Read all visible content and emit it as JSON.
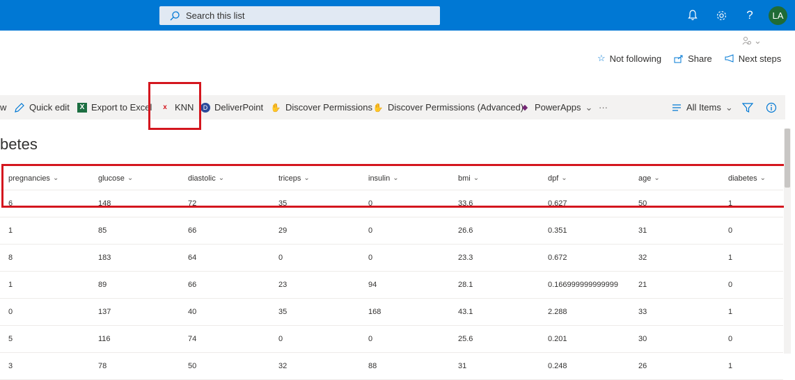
{
  "search": {
    "placeholder": "Search this list"
  },
  "suite": {
    "avatar_initials": "LA"
  },
  "header": {
    "not_following": "Not following",
    "share": "Share",
    "next_steps": "Next steps"
  },
  "commands": {
    "partial_left": "w",
    "quick_edit": "Quick edit",
    "export_excel": "Export to Excel",
    "knn": "KNN",
    "deliverpoint": "DeliverPoint",
    "discover_permissions": "Discover Permissions",
    "discover_permissions_adv": "Discover Permissions (Advanced)",
    "powerapps": "PowerApps",
    "more": "···",
    "all_items": "All Items"
  },
  "list": {
    "title": "betes",
    "columns": [
      "pregnancies",
      "glucose",
      "diastolic",
      "triceps",
      "insulin",
      "bmi",
      "dpf",
      "age",
      "diabetes"
    ],
    "rows": [
      [
        "6",
        "148",
        "72",
        "35",
        "0",
        "33.6",
        "0.627",
        "50",
        "1"
      ],
      [
        "1",
        "85",
        "66",
        "29",
        "0",
        "26.6",
        "0.351",
        "31",
        "0"
      ],
      [
        "8",
        "183",
        "64",
        "0",
        "0",
        "23.3",
        "0.672",
        "32",
        "1"
      ],
      [
        "1",
        "89",
        "66",
        "23",
        "94",
        "28.1",
        "0.166999999999999",
        "21",
        "0"
      ],
      [
        "0",
        "137",
        "40",
        "35",
        "168",
        "43.1",
        "2.288",
        "33",
        "1"
      ],
      [
        "5",
        "116",
        "74",
        "0",
        "0",
        "25.6",
        "0.201",
        "30",
        "0"
      ],
      [
        "3",
        "78",
        "50",
        "32",
        "88",
        "31",
        "0.248",
        "26",
        "1"
      ]
    ]
  },
  "colors": {
    "suite_bar": "#0078d4",
    "highlight": "#d4161e",
    "avatar": "#1f6b35"
  }
}
